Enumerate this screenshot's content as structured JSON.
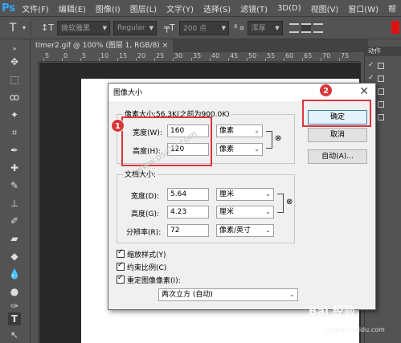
{
  "app": {
    "logo": "Ps"
  },
  "menu": [
    "文件(F)",
    "编辑(E)",
    "图像(I)",
    "图层(L)",
    "文字(Y)",
    "选择(S)",
    "滤镜(T)",
    "3D(D)",
    "视图(V)",
    "窗口(W)",
    "帮"
  ],
  "options": {
    "font_family": "微软雅黑",
    "font_style": "Regular",
    "font_size": "200 点",
    "aa_label": "ª a",
    "aa_mode": "浑厚",
    "accent_color": "#e01010"
  },
  "document": {
    "tab_title": "timer2.gif @ 100% (图层 1, RGB/8) ×",
    "ruler_numbers": [
      "5",
      "0",
      "5",
      "10",
      "15",
      "20",
      "25",
      "30",
      "35",
      "40",
      "45",
      "50",
      "55",
      "60",
      "65",
      "70",
      "75"
    ]
  },
  "panel": {
    "tab_title": "动作"
  },
  "dialog": {
    "title": "图像大小",
    "close": "✕",
    "pixel_group_label": "像素大小:56.3K(之前为900.0K)",
    "width_label": "宽度(W):",
    "width_value": "160",
    "width_unit": "像素",
    "height_label": "高度(H):",
    "height_value": "120",
    "height_unit": "像素",
    "doc_group_label": "文档大小:",
    "doc_width_label": "宽度(D):",
    "doc_width_value": "5.64",
    "doc_width_unit": "厘米",
    "doc_height_label": "高度(G):",
    "doc_height_value": "4.23",
    "doc_height_unit": "厘米",
    "resolution_label": "分辨率(R):",
    "resolution_value": "72",
    "resolution_unit": "像素/英寸",
    "ok": "确定",
    "cancel": "取消",
    "auto": "自动(A)...",
    "scale_styles": "缩放样式(Y)",
    "constrain": "约束比例(C)",
    "resample": "重定图像像素(I):",
    "resample_method": "两次立方 (自动)"
  },
  "annotations": {
    "badge1": "1",
    "badge2": "2",
    "color": "#d9353a"
  },
  "watermark": "www.psahz.com",
  "baidu": {
    "mark": "Bai 经验",
    "url": "jingyan.baidu.com"
  }
}
